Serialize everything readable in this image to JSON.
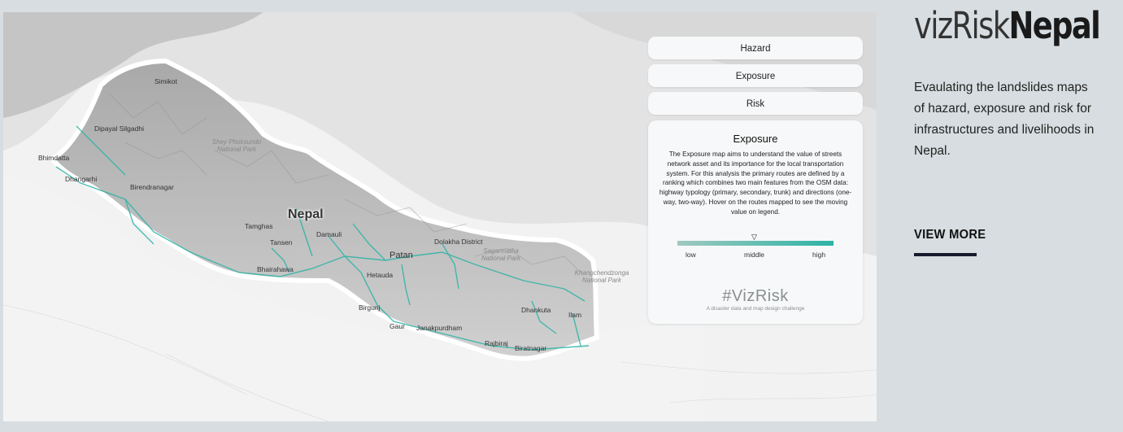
{
  "header": {
    "title_light": "vizRisk",
    "title_bold": "Nepal",
    "description": "Evaulating the landslides maps of hazard, exposure and risk for infrastructures and livelihoods in Nepal.",
    "view_more": "VIEW MORE"
  },
  "map": {
    "country_label": "Nepal",
    "cities": [
      "Simikot",
      "Dipayal Silgadhi",
      "Bhimdatta",
      "Dhangarhi",
      "Birendranagar",
      "Tamghas",
      "Tansen",
      "Damauli",
      "Bhairahawa",
      "Dolakha District",
      "Patan",
      "Hetauda",
      "Birgunj",
      "Gaur",
      "Janakpurdham",
      "Rajbiraj",
      "Biratnagar",
      "Dhankuta",
      "Ilam"
    ],
    "parks": [
      "Shey Phoksundo National Park",
      "Sagarmatha National Park",
      "Khangchendzonga National Park"
    ],
    "route_color": "#2cb3a5"
  },
  "layers": {
    "buttons": [
      "Hazard",
      "Exposure",
      "Risk"
    ]
  },
  "panel": {
    "title": "Exposure",
    "text": "The Exposure map aims to understand the value of streets network asset and its importance for the local transportation system. For this analysis the primary routes are defined by a ranking which combines two main features from the OSM data: highway typology (primary, secondary, trunk) and directions (one-way, two-way). Hover on the routes mapped to see the moving value on legend.",
    "legend": {
      "low": "low",
      "middle": "middle",
      "high": "high",
      "marker": "▽"
    },
    "brand": "#VizRisk",
    "brand_sub": "A disaster data and map design challenge"
  }
}
